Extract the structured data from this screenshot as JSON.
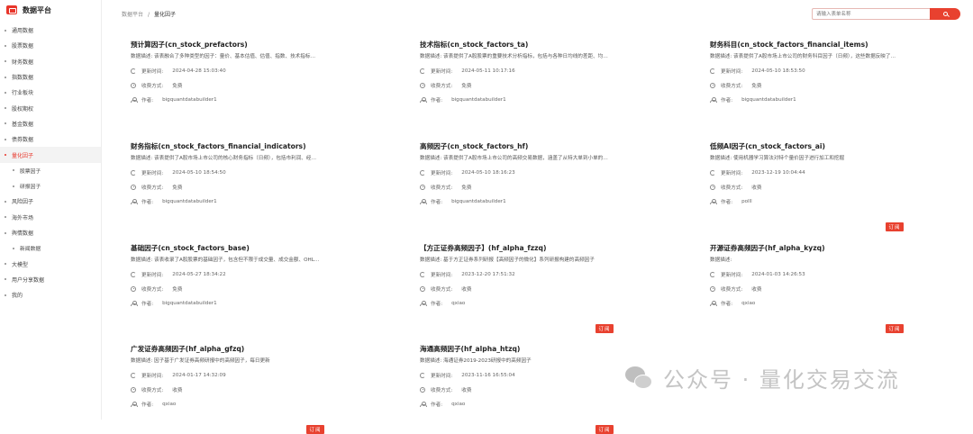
{
  "app": {
    "title": "数据平台"
  },
  "sidebar": {
    "items": [
      {
        "label": "通用数据",
        "sub": false,
        "active": false
      },
      {
        "label": "股票数据",
        "sub": false,
        "active": false
      },
      {
        "label": "财务数据",
        "sub": false,
        "active": false
      },
      {
        "label": "指数数据",
        "sub": false,
        "active": false
      },
      {
        "label": "行业板块",
        "sub": false,
        "active": false
      },
      {
        "label": "股权期权",
        "sub": false,
        "active": false
      },
      {
        "label": "基金数据",
        "sub": false,
        "active": false
      },
      {
        "label": "债券数据",
        "sub": false,
        "active": false
      },
      {
        "label": "量化因子",
        "sub": false,
        "active": true
      },
      {
        "label": "股票因子",
        "sub": true,
        "active": false
      },
      {
        "label": "研报因子",
        "sub": true,
        "active": false
      },
      {
        "label": "风险因子",
        "sub": false,
        "active": false
      },
      {
        "label": "海外市场",
        "sub": false,
        "active": false
      },
      {
        "label": "舆情数据",
        "sub": false,
        "active": false
      },
      {
        "label": "新闻数据",
        "sub": true,
        "active": false
      },
      {
        "label": "大模型",
        "sub": false,
        "active": false
      },
      {
        "label": "用户分享数据",
        "sub": false,
        "active": false
      },
      {
        "label": "我的",
        "sub": false,
        "active": false
      }
    ]
  },
  "breadcrumb": {
    "root": "数据平台",
    "separator": "/",
    "current": "量化因子"
  },
  "search": {
    "placeholder": "请输入表单名称"
  },
  "labels": {
    "updated": "更新时间:",
    "fee": "收费方式:",
    "author": "作者:",
    "subscribe": "订阅"
  },
  "cards": [
    {
      "title": "预计算因子(cn_stock_prefactors)",
      "desc": "数据描述:   该表融合了多种类型的因子：量价、基本估值、估值、指数、技术指标、财务因子等。该表是…",
      "updated": "2024-04-28 15:03:40",
      "fee": "免费",
      "author": "bigquantdatabuilder1",
      "subscribe": false
    },
    {
      "title": "技术指标(cn_stock_factors_ta)",
      "desc": "数据描述:   该表提供了A股股票的重要技术分析指标，包括与各种日均线的差距、均线交叉情况、K线模式…",
      "updated": "2024-05-11 10:17:16",
      "fee": "免费",
      "author": "bigquantdatabuilder1",
      "subscribe": false
    },
    {
      "title": "财务科目(cn_stock_factors_financial_items)",
      "desc": "数据描述:   该表提供了A股市场上市公司的财务科目因子（日频），这些数据反映了公司的财务状况和经…",
      "updated": "2024-05-10 18:53:50",
      "fee": "免费",
      "author": "bigquantdatabuilder1",
      "subscribe": false
    },
    {
      "title": "财务指标(cn_stock_factors_financial_indicators)",
      "desc": "数据描述:   该表提供了A股市场上市公司的核心财务指标（日频），包括市利润、经营活动净收益、价格…",
      "updated": "2024-05-10 18:54:50",
      "fee": "免费",
      "author": "bigquantdatabuilder1",
      "subscribe": false
    },
    {
      "title": "高频因子(cn_stock_factors_hf)",
      "desc": "数据描述:   该表提供了A股市场上市公司的高频交易数据，涵盖了从特大单到小单的买入成交笔数、买入…",
      "updated": "2024-05-10 18:16:23",
      "fee": "免费",
      "author": "bigquantdatabuilder1",
      "subscribe": false
    },
    {
      "title": "低频AI因子(cn_stock_factors_ai)",
      "desc": "数据描述:   使用机器学习算法对特个量价因子进行加工和挖掘",
      "updated": "2023-12-19 10:04:44",
      "fee": "收费",
      "author": "polll",
      "subscribe": true
    },
    {
      "title": "基础因子(cn_stock_factors_base)",
      "desc": "数据描述:   该表收录了A股股票的基础因子，包含但不限于成交量、成交金额、OHLC（开盘价收、均为后…",
      "updated": "2024-05-27 18:34:22",
      "fee": "免费",
      "author": "bigquantdatabuilder1",
      "subscribe": false
    },
    {
      "title": "【方正证券高频因子】(hf_alpha_fzzq)",
      "desc": "数据描述:   基于方正证券系列研报【高频因子的微化】系列研报构建的高频因子",
      "updated": "2023-12-20 17:51:32",
      "fee": "收费",
      "author": "qxiao",
      "subscribe": true
    },
    {
      "title": "开源证券高频因子(hf_alpha_kyzq)",
      "desc": "数据描述:",
      "updated": "2024-01-03 14:26:53",
      "fee": "收费",
      "author": "qxiao",
      "subscribe": true
    },
    {
      "title": "广发证券高频因子(hf_alpha_gfzq)",
      "desc": "数据描述:   因子基于广发证券高频研报中的高频因子，每日更新",
      "updated": "2024-01-17 14:32:09",
      "fee": "收费",
      "author": "qxiao",
      "subscribe": true
    },
    {
      "title": "海通高频因子(hf_alpha_htzq)",
      "desc": "数据描述:   海通证券2019-2023研报中的高频因子",
      "updated": "2023-11-16 16:55:04",
      "fee": "收费",
      "author": "qxiao",
      "subscribe": true
    }
  ],
  "watermark": {
    "text": "公众号 · 量化交易交流"
  },
  "colors": {
    "accent": "#e8412f",
    "active_bg": "#f3f3f3"
  }
}
